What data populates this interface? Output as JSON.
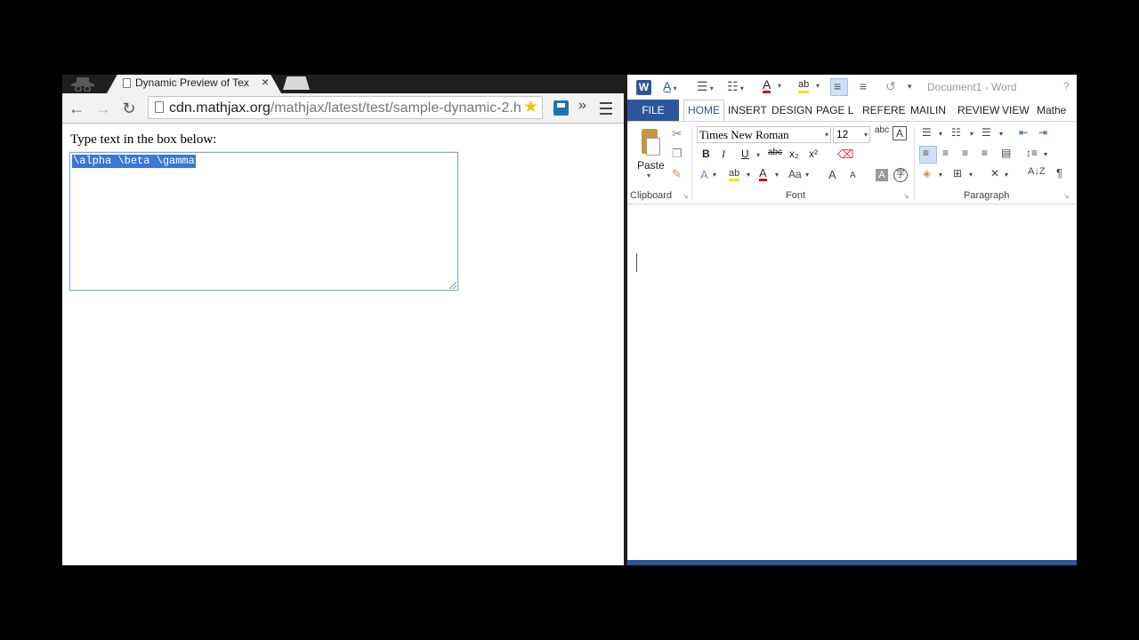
{
  "chrome": {
    "tab_title": "Dynamic Preview of Tex",
    "tab_close": "×",
    "url_host": "cdn.mathjax.org",
    "url_path": "/mathjax/latest/test/sample-dynamic-2.h",
    "back": "←",
    "forward": "→",
    "reload": "↻",
    "star": "★",
    "overflow": "»",
    "page_label": "Type text in the box below:",
    "textarea_value": "\\alpha \\beta \\gamma"
  },
  "word": {
    "app_letter": "W",
    "doc_title": "Document1 - Word",
    "help": "?",
    "tabs": {
      "file": "FILE",
      "home": "HOME",
      "insert": "INSERT",
      "design": "DESIGN",
      "page_layout": "PAGE L",
      "references": "REFERE",
      "mailings": "MAILIN",
      "review": "REVIEW",
      "view": "VIEW",
      "math": "Mathe"
    },
    "clipboard": {
      "paste_label": "Paste",
      "group_label": "Clipboard"
    },
    "font": {
      "family": "Times New Roman",
      "size": "12",
      "bold": "B",
      "italic": "I",
      "underline": "U",
      "strike": "abc",
      "subscript": "x₂",
      "superscript": "x²",
      "text_effects": "A",
      "font_color": "A",
      "change_case": "Aa",
      "grow": "A",
      "shrink": "A",
      "group_label": "Font"
    },
    "paragraph": {
      "show_marks": "¶",
      "group_label": "Paragraph"
    }
  }
}
